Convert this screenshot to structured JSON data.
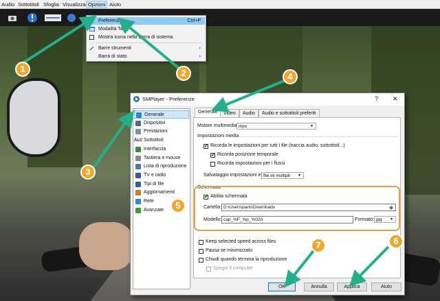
{
  "menubar": {
    "items": [
      "Audio",
      "Sottotitoli",
      "Sfoglia",
      "Visualizza",
      "Opzioni",
      "Aiuto"
    ],
    "active": "Opzioni"
  },
  "dropdown": {
    "items": [
      {
        "label": "Preferenze",
        "shortcut": "Ctrl+P",
        "icon": "wrench-screwdriver-icon",
        "highlighted": true
      },
      {
        "label": "Modalità Tab",
        "shortcut": "",
        "icon": "window-icon"
      },
      {
        "label": "Mostra icona nella barra di sistema",
        "shortcut": "",
        "icon": "checkbox"
      },
      {
        "label": "Barre strumenti",
        "shortcut": "",
        "icon": "tools-icon",
        "submenu": true
      },
      {
        "label": "Barra di stato",
        "shortcut": "",
        "icon": "",
        "submenu": true
      }
    ]
  },
  "dialog": {
    "title": "SMPlayer - Preferenze",
    "help": "?",
    "close": "✕",
    "sections": [
      {
        "label": "Generale",
        "color": "#2e7fd6",
        "selected": true
      },
      {
        "label": "Dispositivi",
        "color": "#5b6a7a"
      },
      {
        "label": "Prestazioni",
        "color": "#7c8fa3"
      },
      {
        "label": "Sottotitoli",
        "color": "#333333",
        "icon_text": "ÄLC"
      },
      {
        "label": "Interfaccia",
        "color": "#3c8d3c"
      },
      {
        "label": "Tastiera e mouse",
        "color": "#8a8a8a"
      },
      {
        "label": "Lista di riproduzione",
        "color": "#4a76b6"
      },
      {
        "label": "TV e radio",
        "color": "#335a99"
      },
      {
        "label": "Tipi di file",
        "color": "#2c5fa8"
      },
      {
        "label": "Aggiornamenti",
        "color": "#d87a1c"
      },
      {
        "label": "Rete",
        "color": "#2f8ad6"
      },
      {
        "label": "Avanzate",
        "color": "#2aa82a"
      }
    ],
    "tabs": [
      "Generale",
      "Video",
      "Audio",
      "Audio e sottotitoli preferiti"
    ],
    "active_tab": "Generale",
    "general": {
      "engine_label": "Motore multimediale:",
      "engine_value": "mpv",
      "media_settings_title": "Impostazioni media",
      "remember_label": "Ricorda le impostazioni per tutti i file (traccia audio, sottotitoli...)",
      "remember_checked": true,
      "remember_time_label": "Ricorda posizione temporale",
      "remember_time_checked": true,
      "remember_streams_label": "Ricorda impostazioni per i flussi",
      "remember_streams_checked": false,
      "save_settings_label": "Salvataggio impostazioni in",
      "save_settings_value": "file ini multipli",
      "screenshot_title": "Schermata",
      "enable_screenshot_label": "Abilita schermata",
      "enable_screenshot_checked": true,
      "folder_label": "Cartella:",
      "folder_value": "D:\\Users\\paris\\Downloads",
      "template_label": "Modello:",
      "template_value": "cap_%F_%p_%02n",
      "format_label": "Formato:",
      "format_value": "jpg",
      "keep_speed_label": "Keep selected speed across files",
      "keep_speed_checked": false,
      "pause_min_label": "Pausa se minimizzato",
      "pause_min_checked": false,
      "close_end_label": "Chiudi quando termina la riproduzione",
      "close_end_checked": false,
      "shutdown_label": "Spegni il computer",
      "shutdown_checked": false
    },
    "buttons": {
      "ok": "OK",
      "cancel": "Annulla",
      "apply": "Applica",
      "help": "Aiuto"
    }
  },
  "callouts": [
    "1",
    "2",
    "3",
    "4",
    "5",
    "6",
    "7"
  ],
  "colors": {
    "callout": "#f0a82a",
    "arrow": "#22b08a",
    "highlight_box": "#e8a23a",
    "selection": "#cde8ff"
  }
}
